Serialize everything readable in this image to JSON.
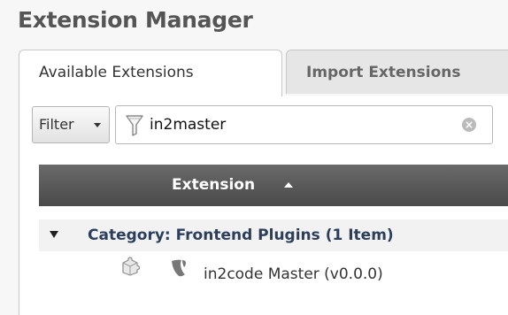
{
  "page": {
    "title": "Extension Manager"
  },
  "tabs": [
    {
      "label": "Available Extensions",
      "active": true
    },
    {
      "label": "Import Extensions",
      "active": false
    }
  ],
  "filter": {
    "button_label": "Filter",
    "search_value": "in2master",
    "icons": {
      "dropdown": "caret-down-icon",
      "funnel": "funnel-icon",
      "clear": "clear-search-icon"
    }
  },
  "table": {
    "header": {
      "label": "Extension",
      "sort": "ascending"
    },
    "category": {
      "label": "Category: Frontend Plugins (1 Item)",
      "expanded": true
    },
    "rows": [
      {
        "label": "in2code Master (v0.0.0)",
        "icons": [
          "puzzle-extension-icon",
          "typo3-logo-icon"
        ]
      }
    ]
  },
  "colors": {
    "header_bg": "#555555",
    "category_text": "#2b3f5c",
    "title_text": "#555555"
  }
}
